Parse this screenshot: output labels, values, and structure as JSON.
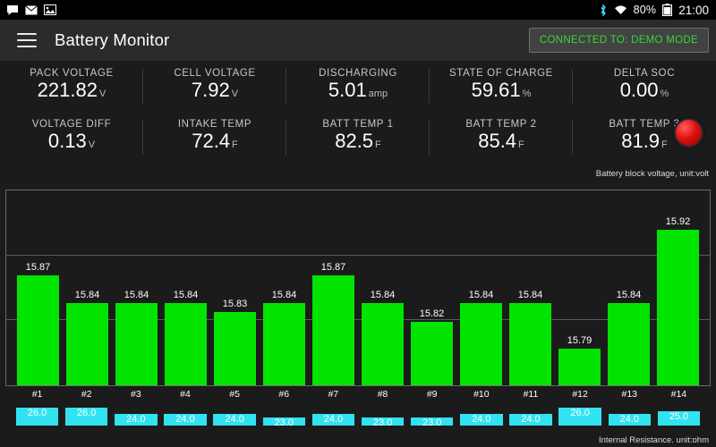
{
  "statusbar": {
    "left_icons": [
      "chat-icon",
      "mail-icon",
      "image-icon"
    ],
    "right_icons": [
      "bluetooth-icon",
      "wifi-icon"
    ],
    "battery_percent": "80%",
    "clock": "21:00"
  },
  "appbar": {
    "menu_icon": "hamburger-icon",
    "title": "Battery Monitor",
    "connection_badge": "CONNECTED TO: DEMO MODE",
    "badge_color": "#36d936"
  },
  "metrics": {
    "row1": [
      {
        "label": "PACK VOLTAGE",
        "value": "221.82",
        "unit": "V"
      },
      {
        "label": "CELL VOLTAGE",
        "value": "7.92",
        "unit": "V"
      },
      {
        "label": "DISCHARGING",
        "value": "5.01",
        "unit": "amp"
      },
      {
        "label": "STATE OF CHARGE",
        "value": "59.61",
        "unit": "%"
      },
      {
        "label": "DELTA SOC",
        "value": "0.00",
        "unit": "%"
      }
    ],
    "row2": [
      {
        "label": "VOLTAGE DIFF",
        "value": "0.13",
        "unit": "V"
      },
      {
        "label": "INTAKE TEMP",
        "value": "72.4",
        "unit": "F"
      },
      {
        "label": "BATT TEMP 1",
        "value": "82.5",
        "unit": "F"
      },
      {
        "label": "BATT TEMP 2",
        "value": "85.4",
        "unit": "F"
      },
      {
        "label": "BATT TEMP 3",
        "value": "81.9",
        "unit": "F"
      }
    ],
    "status_led": "status-led-red"
  },
  "chart_data": {
    "type": "bar",
    "title": "Battery block voltage, unit:volt",
    "subtitle": "Internal Resistance. unit:ohm",
    "xlabel": "",
    "ylabel": "",
    "categories": [
      "#1",
      "#2",
      "#3",
      "#4",
      "#5",
      "#6",
      "#7",
      "#8",
      "#9",
      "#10",
      "#11",
      "#12",
      "#13",
      "#14"
    ],
    "values": [
      15.87,
      15.84,
      15.84,
      15.84,
      15.83,
      15.84,
      15.87,
      15.84,
      15.82,
      15.84,
      15.84,
      15.79,
      15.84,
      15.92
    ],
    "value_labels": [
      "15.87",
      "15.84",
      "15.84",
      "15.84",
      "15.83",
      "15.84",
      "15.87",
      "15.84",
      "15.82",
      "15.84",
      "15.84",
      "15.79",
      "15.84",
      "15.92"
    ],
    "ylim": [
      15.75,
      15.94
    ],
    "grid": true,
    "bar_color": "#00e400",
    "resistance": {
      "type": "bar",
      "title": "Internal Resistance. unit:ohm",
      "categories": [
        "#1",
        "#2",
        "#3",
        "#4",
        "#5",
        "#6",
        "#7",
        "#8",
        "#9",
        "#10",
        "#11",
        "#12",
        "#13",
        "#14"
      ],
      "values": [
        26.0,
        26.0,
        24.0,
        24.0,
        24.0,
        23.0,
        24.0,
        23.0,
        23.0,
        24.0,
        24.0,
        26.0,
        24.0,
        25.0
      ],
      "value_labels": [
        "26.0",
        "26.0",
        "24.0",
        "24.0",
        "24.0",
        "23.0",
        "24.0",
        "23.0",
        "23.0",
        "24.0",
        "24.0",
        "26.0",
        "24.0",
        "25.0"
      ],
      "bar_color": "#31e3f0"
    }
  }
}
